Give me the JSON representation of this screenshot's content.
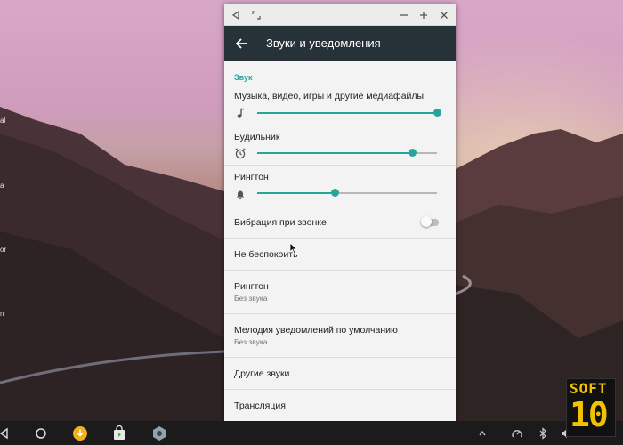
{
  "window": {
    "title": "Звуки и уведомления"
  },
  "settings": {
    "section_header": "Звук",
    "media": {
      "label": "Музыка, видео, игры и другие медиафайлы",
      "level": 1.0
    },
    "alarm": {
      "label": "Будильник",
      "level": 0.86
    },
    "ringtone_volume": {
      "label": "Рингтон",
      "level": 0.43
    },
    "vibrate": {
      "label": "Вибрация при звонке",
      "enabled": false
    },
    "dnd": {
      "label": "Не беспокоить"
    },
    "ringtone": {
      "label": "Рингтон",
      "value": "Без звука"
    },
    "notification_sound": {
      "label": "Мелодия уведомлений по умолчанию",
      "value": "Без звука"
    },
    "other_sounds": {
      "label": "Другие звуки"
    },
    "cast": {
      "label": "Трансляция"
    }
  },
  "accent_color": "#26a69a",
  "appbar_color": "#263238",
  "desktop": {
    "edge_labels": [
      "al",
      "a",
      "or",
      "n"
    ]
  },
  "watermark": {
    "line1": "SOFT",
    "line2": "10"
  },
  "icons": {
    "titlebar": [
      "back-triangle-icon",
      "resize-icon",
      "minimize-icon",
      "maximize-icon",
      "close-icon"
    ],
    "taskbar": [
      "back-icon",
      "home-icon",
      "download-app-icon",
      "store-app-icon",
      "settings-app-icon",
      "chevron-up-icon",
      "performance-icon",
      "bluetooth-icon",
      "volume-icon"
    ]
  }
}
